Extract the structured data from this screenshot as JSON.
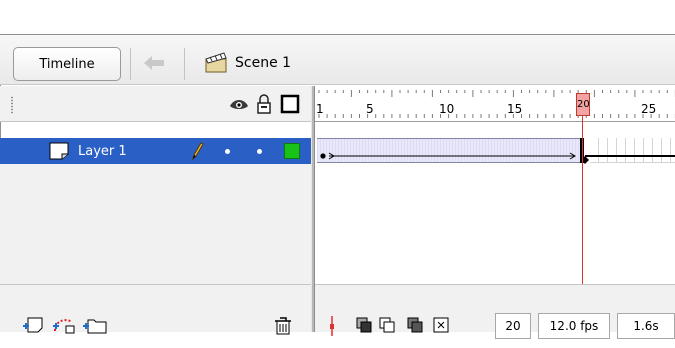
{
  "toolbar": {
    "timeline_label": "Timeline",
    "scene_label": "Scene 1"
  },
  "ruler": {
    "ticks": [
      "1",
      "5",
      "10",
      "15",
      "20",
      "25"
    ],
    "current_frame_marker": "20"
  },
  "layers": [
    {
      "name": "Layer 1",
      "selected": true
    }
  ],
  "status": {
    "current_frame": "20",
    "frame_rate": "12.0 fps",
    "elapsed_time": "1.6s"
  },
  "colors": {
    "selection": "#2a5fc6",
    "playhead": "#e03030",
    "outline": "#19c219"
  },
  "icons": {
    "header": [
      "eye-icon",
      "lock-icon",
      "outline-square-icon"
    ],
    "layer": [
      "layer-icon",
      "pencil-icon",
      "dot-icon",
      "dot-icon",
      "outline-color-icon"
    ],
    "bottom_left": [
      "insert-layer-icon",
      "add-motion-guide-icon",
      "insert-folder-icon",
      "trash-icon"
    ],
    "bottom_right": [
      "center-frame-icon",
      "onion-skin-icon",
      "onion-skin-outlines-icon",
      "edit-multiple-frames-icon",
      "modify-onion-markers-icon"
    ]
  }
}
